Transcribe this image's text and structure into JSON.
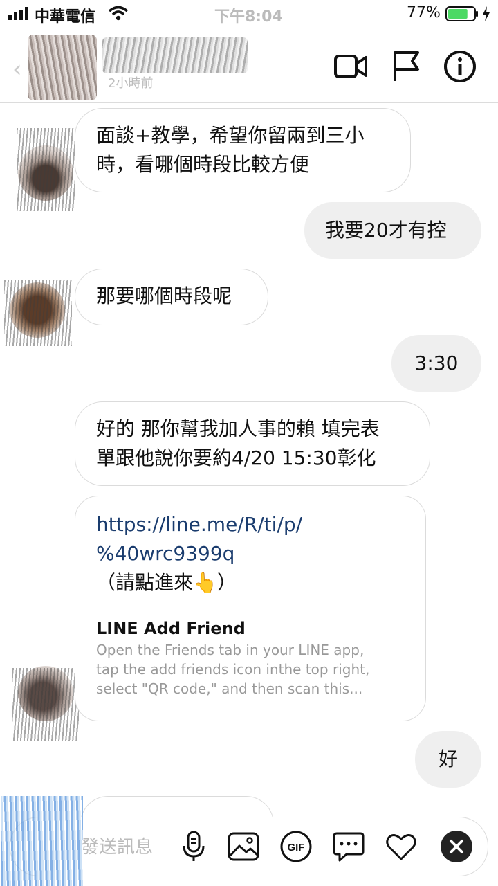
{
  "status_bar": {
    "carrier": "中華電信",
    "time": "下午8:04",
    "battery_percent": "77%",
    "battery_level": 0.77,
    "battery_color": "#4cd964"
  },
  "header": {
    "contact_name": "",
    "subtitle": "2小時前",
    "icons": [
      "back-chevron-icon",
      "video-call-icon",
      "flag-icon",
      "info-icon"
    ]
  },
  "messages": [
    {
      "side": "in",
      "text_line1": "面談+教學，希望你留兩到三小",
      "text_line2": "時，看哪個時段比較方便"
    },
    {
      "side": "out",
      "text": "我要20才有控"
    },
    {
      "side": "in",
      "text": "那要哪個時段呢"
    },
    {
      "side": "out",
      "text": "3:30"
    },
    {
      "side": "in",
      "text_line1": "好的 那你幫我加人事的賴 填完表",
      "text_line2": "單跟他說你要約4/20 15:30彰化"
    },
    {
      "side": "in",
      "link_line1": "https://line.me/R/ti/p/",
      "link_line2": "%40wrc9399q",
      "note": "（請點進來👆）",
      "card_title": "LINE Add Friend",
      "card_desc_line1": "Open the Friends tab in your LINE app,",
      "card_desc_line2": "tap the add friends icon inthe top right,",
      "card_desc_line3": "select \"QR code,\" and then scan this..."
    },
    {
      "side": "out",
      "text": "好"
    }
  ],
  "composer": {
    "placeholder": "發送訊息",
    "icons": [
      "microphone-icon",
      "image-icon",
      "gif-icon",
      "sticker-icon",
      "heart-icon",
      "close-icon"
    ],
    "gif_label": "GIF"
  },
  "colors": {
    "link": "#1a3c6e",
    "outgoing_bubble": "#efefef",
    "bubble_border": "#dbdbdb"
  }
}
